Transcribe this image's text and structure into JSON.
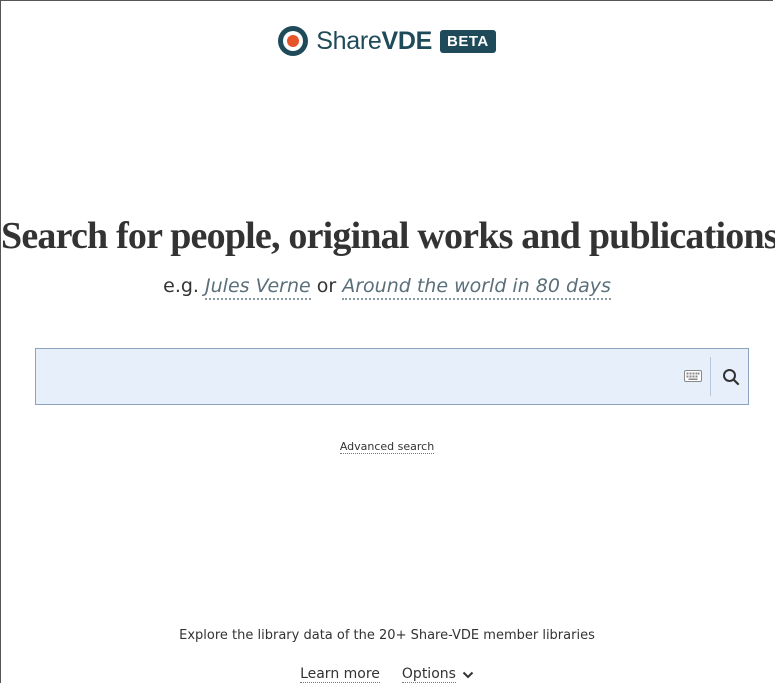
{
  "brand": {
    "name_light": "Share",
    "name_bold": "VDE",
    "badge": "BETA",
    "color": "#1f4a5a",
    "accent": "#e8542a"
  },
  "headline": "Search for people, original works and publications",
  "examples": {
    "prefix": "e.g.",
    "first": "Jules Verne",
    "joiner": "or",
    "second": "Around the world in 80 days"
  },
  "search": {
    "value": "",
    "placeholder": "",
    "keyboard_icon": "keyboard-icon",
    "search_icon": "search-icon"
  },
  "advanced_search": "Advanced search",
  "footer": {
    "explore_text": "Explore the library data of the 20+ Share-VDE member libraries",
    "learn_more": "Learn more",
    "options": "Options"
  }
}
